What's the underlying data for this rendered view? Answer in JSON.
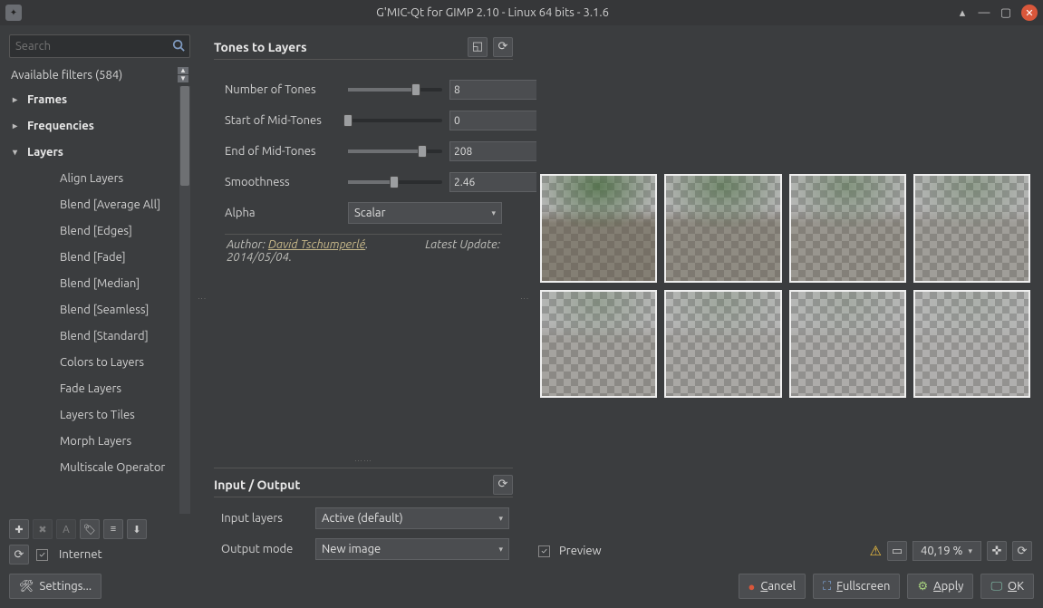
{
  "window": {
    "title": "G'MIC-Qt for GIMP 2.10 - Linux 64 bits - 3.1.6"
  },
  "search": {
    "placeholder": "Search"
  },
  "filters_header": "Available filters (584)",
  "tree": {
    "groups": [
      {
        "label": "Frames",
        "expanded": false
      },
      {
        "label": "Frequencies",
        "expanded": false
      },
      {
        "label": "Layers",
        "expanded": true
      }
    ],
    "children": [
      "Align Layers",
      "Blend [Average All]",
      "Blend [Edges]",
      "Blend [Fade]",
      "Blend [Median]",
      "Blend [Seamless]",
      "Blend [Standard]",
      "Colors to Layers",
      "Fade Layers",
      "Layers to Tiles",
      "Morph Layers",
      "Multiscale Operator"
    ]
  },
  "internet_label": "Internet",
  "filter_title": "Tones to Layers",
  "params": {
    "num_tones": {
      "label": "Number of Tones",
      "value": "8",
      "pct": 72
    },
    "start_mid": {
      "label": "Start of Mid-Tones",
      "value": "0",
      "pct": 0
    },
    "end_mid": {
      "label": "End of Mid-Tones",
      "value": "208",
      "pct": 79
    },
    "smooth": {
      "label": "Smoothness",
      "value": "2.46",
      "pct": 49
    },
    "alpha": {
      "label": "Alpha",
      "value": "Scalar"
    }
  },
  "author": {
    "prefix": "Author: ",
    "name": "David Tschumperlé",
    "date_label": "2014/05/04.",
    "update_label": "Latest Update:"
  },
  "io": {
    "title": "Input / Output",
    "input_label": "Input layers",
    "input_value": "Active (default)",
    "output_label": "Output mode",
    "output_value": "New image"
  },
  "preview": {
    "label": "Preview",
    "zoom": "40,19 %"
  },
  "buttons": {
    "settings": "Settings...",
    "cancel": "Cancel",
    "fullscreen": "Fullscreen",
    "apply": "Apply",
    "ok": "OK"
  }
}
